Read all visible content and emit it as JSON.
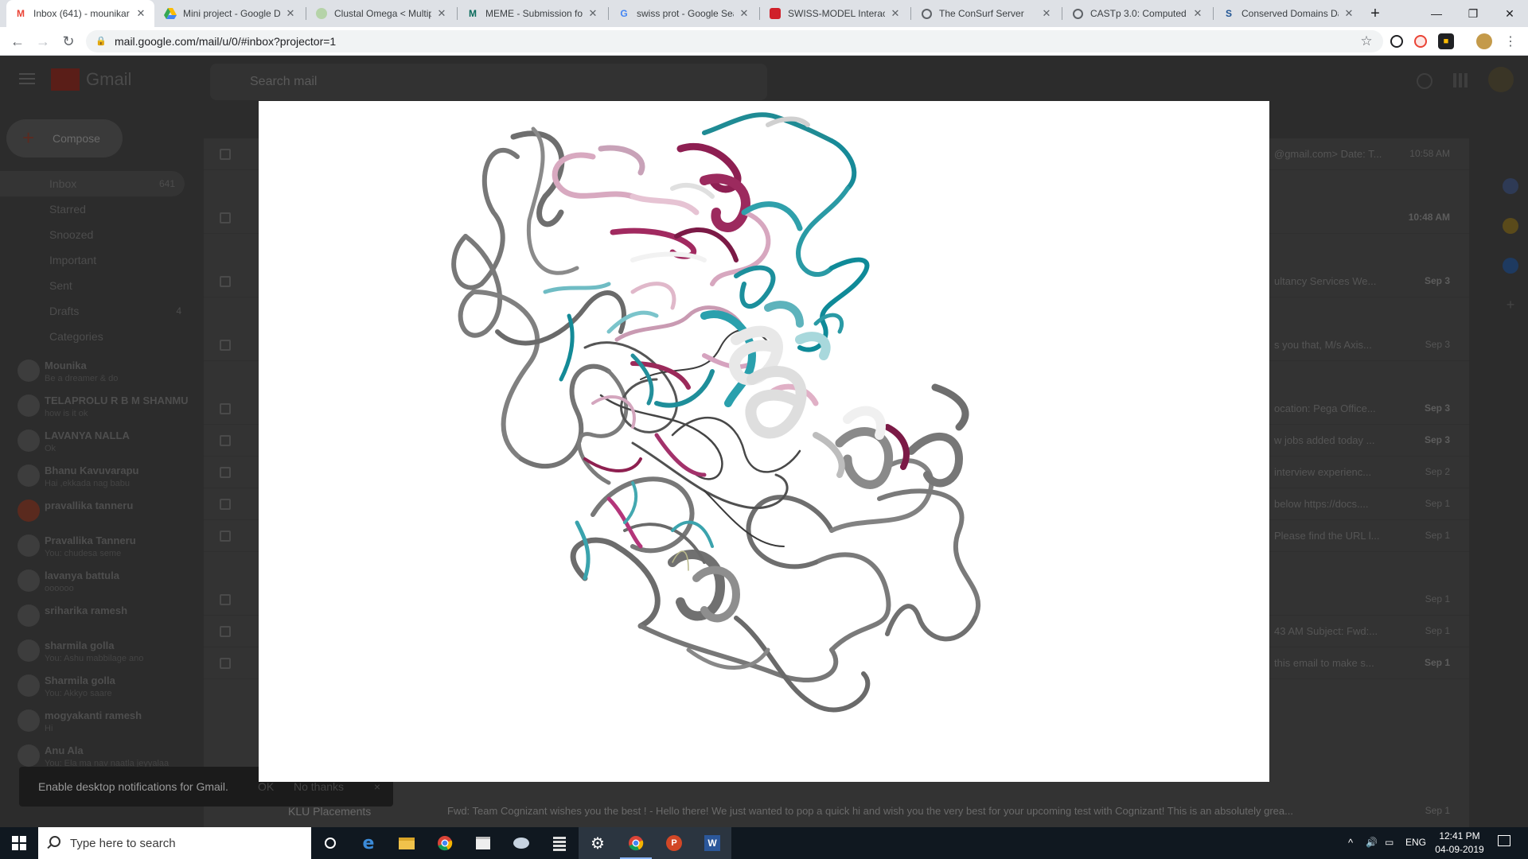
{
  "browser": {
    "tabs": [
      {
        "title": "Inbox (641) - mounikar",
        "favicon": "gmail-icon",
        "active": true
      },
      {
        "title": "Mini project - Google D",
        "favicon": "drive-icon"
      },
      {
        "title": "Clustal Omega < Multip",
        "favicon": "clustal-icon"
      },
      {
        "title": "MEME - Submission for",
        "favicon": "meme-icon"
      },
      {
        "title": "swiss prot - Google Sea",
        "favicon": "google-icon"
      },
      {
        "title": "SWISS-MODEL Interact",
        "favicon": "swissmodel-icon"
      },
      {
        "title": "The ConSurf Server",
        "favicon": "globe-icon"
      },
      {
        "title": "CASTp 3.0: Computed A",
        "favicon": "globe-icon"
      },
      {
        "title": "Conserved Domains Da",
        "favicon": "ncbi-icon"
      }
    ],
    "url": "mail.google.com/mail/u/0/#inbox?projector=1"
  },
  "gmail": {
    "brand": "Gmail",
    "search_placeholder": "Search mail",
    "compose_label": "Compose",
    "sidebar": [
      {
        "label": "Inbox",
        "count": "641"
      },
      {
        "label": "Starred",
        "count": ""
      },
      {
        "label": "Snoozed",
        "count": ""
      },
      {
        "label": "Important",
        "count": ""
      },
      {
        "label": "Sent",
        "count": ""
      },
      {
        "label": "Drafts",
        "count": "4"
      },
      {
        "label": "Categories",
        "count": ""
      }
    ],
    "hangouts": [
      {
        "name": "Mounika",
        "status": "Be a dreamer & do"
      },
      {
        "name": "TELAPROLU R B M SHANMU",
        "status": "how is it ok"
      },
      {
        "name": "LAVANYA NALLA",
        "status": "Ok"
      },
      {
        "name": "Bhanu Kavuvarapu",
        "status": "Hai ,ekkada nag babu"
      },
      {
        "name": "pravallika tanneru",
        "status": ""
      },
      {
        "name": "Pravallika Tanneru",
        "status": "You: chudesa seme"
      },
      {
        "name": "lavanya battula",
        "status": "oooooo"
      },
      {
        "name": "sriharika ramesh",
        "status": ""
      },
      {
        "name": "sharmila golla",
        "status": "You: Ashu mabbilage ano"
      },
      {
        "name": "Sharmila golla",
        "status": "You: Akkyo saare"
      },
      {
        "name": "mogyakanti ramesh",
        "status": "Hi"
      },
      {
        "name": "Anu Ala",
        "status": "You: Ela ma nav naatla jeyyalaa"
      }
    ],
    "emails": [
      {
        "snippet": "@gmail.com> Date: T...",
        "date": "10:58 AM",
        "bold": false
      },
      {
        "snippet": "",
        "date": "10:48 AM",
        "bold": true
      },
      {
        "snippet": "ultancy Services We...",
        "date": "Sep 3",
        "bold": true
      },
      {
        "snippet": "s you that, M/s Axis...",
        "date": "Sep 3",
        "bold": false
      },
      {
        "snippet": "ocation: Pega Office...",
        "date": "Sep 3",
        "bold": true
      },
      {
        "snippet": "w jobs added today ...",
        "date": "Sep 3",
        "bold": true
      },
      {
        "snippet": "interview experienc...",
        "date": "Sep 2",
        "bold": false
      },
      {
        "snippet": "below https://docs....",
        "date": "Sep 1",
        "bold": false
      },
      {
        "snippet": "Please find the URL l...",
        "date": "Sep 1",
        "bold": false
      },
      {
        "snippet": "",
        "date": "Sep 1",
        "bold": false
      },
      {
        "snippet": "43 AM Subject: Fwd:...",
        "date": "Sep 1",
        "bold": false
      },
      {
        "snippet": "this email to make s...",
        "date": "Sep 1",
        "bold": true
      }
    ],
    "last_email": {
      "sender": "KLU Placements",
      "text": "Fwd: Team Cognizant wishes you the best ! - Hello there! We just wanted to pop a quick hi and wish you the very best for your upcoming test with Cognizant! This is an absolutely grea...",
      "date": "Sep 1"
    },
    "notification": {
      "text": "Enable desktop notifications for Gmail.",
      "ok": "OK",
      "no": "No thanks",
      "close": "×"
    }
  },
  "taskbar": {
    "search_placeholder": "Type here to search",
    "language": "ENG",
    "time": "12:41 PM",
    "date": "04-09-2019"
  }
}
